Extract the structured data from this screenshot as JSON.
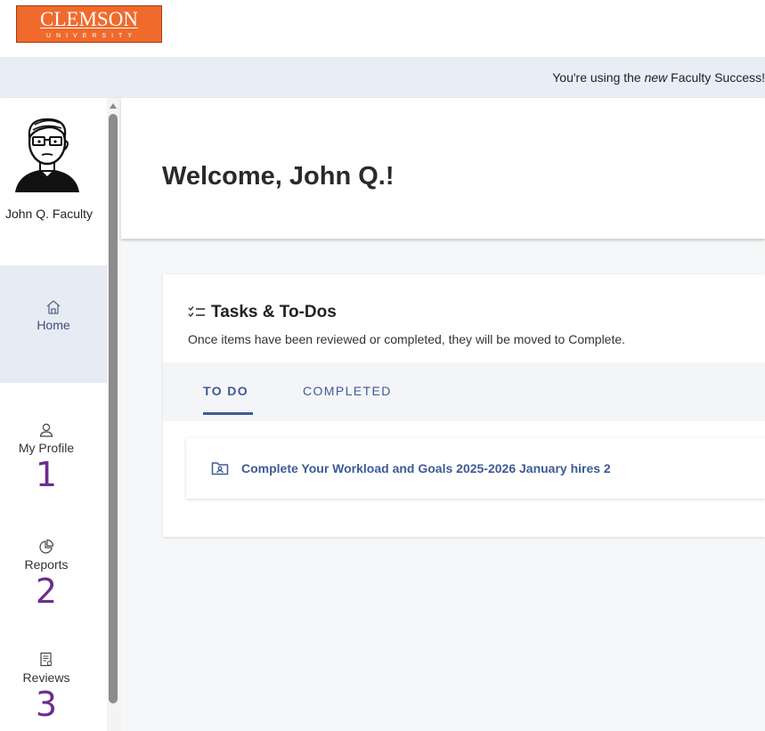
{
  "header": {
    "logo_text": "CLEMSON",
    "logo_subtext": "UNIVERSITY"
  },
  "banner": {
    "text_before": "You're using the ",
    "text_em": "new",
    "text_after": " Faculty Success!"
  },
  "sidebar": {
    "user_name": "John Q. Faculty",
    "nav": [
      {
        "label": "Home",
        "icon": "home-icon",
        "active": true
      },
      {
        "label": "My Profile",
        "icon": "person-icon",
        "number": "1"
      },
      {
        "label": "Reports",
        "icon": "pie-chart-icon",
        "number": "2"
      },
      {
        "label": "Reviews",
        "icon": "review-document-icon",
        "number": "3"
      }
    ]
  },
  "main": {
    "welcome": "Welcome, John Q.!",
    "tasks": {
      "title": "Tasks & To-Dos",
      "subtitle": "Once items have been reviewed or completed, they will be moved to Complete.",
      "tabs": [
        {
          "label": "TO DO",
          "active": true
        },
        {
          "label": "COMPLETED",
          "active": false
        }
      ],
      "items": [
        {
          "label": "Complete Your Workload and Goals 2025-2026 January hires 2",
          "icon": "folder-user-icon"
        }
      ]
    }
  },
  "colors": {
    "clemson_orange": "#f06a2c",
    "link_blue": "#3d5b94",
    "annotation_purple": "#6b2d8e",
    "banner_bg": "#e8edf6"
  }
}
